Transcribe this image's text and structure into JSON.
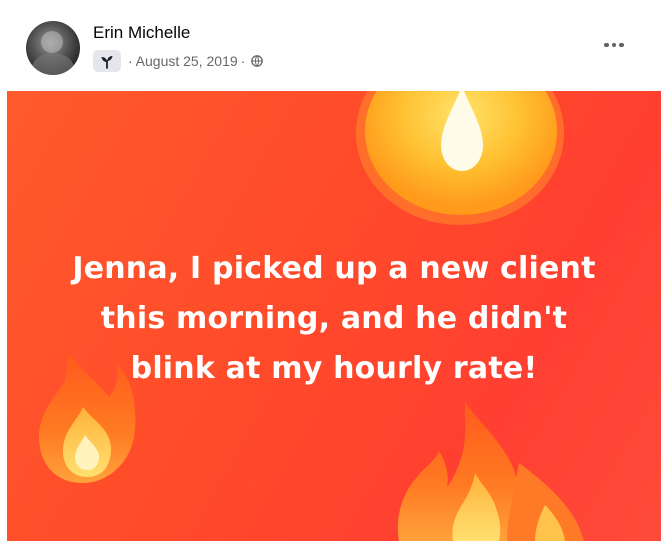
{
  "post": {
    "author": "Erin Michelle",
    "date": "August 25, 2019",
    "separator": "·",
    "audience_icon": "globe-icon",
    "badge_icon": "sprout-icon",
    "more_icon": "more-options-icon",
    "text_lines": [
      "Jenna, I picked up a new client",
      "this morning, and he didn't",
      "blink at my hourly rate!"
    ]
  },
  "colors": {
    "background_start": "#ff5a2c",
    "background_end": "#ff3f31",
    "flame_outer": "#ff7a1f",
    "flame_inner": "#ffd84a",
    "text": "#ffffff",
    "meta_text": "#65676b"
  }
}
